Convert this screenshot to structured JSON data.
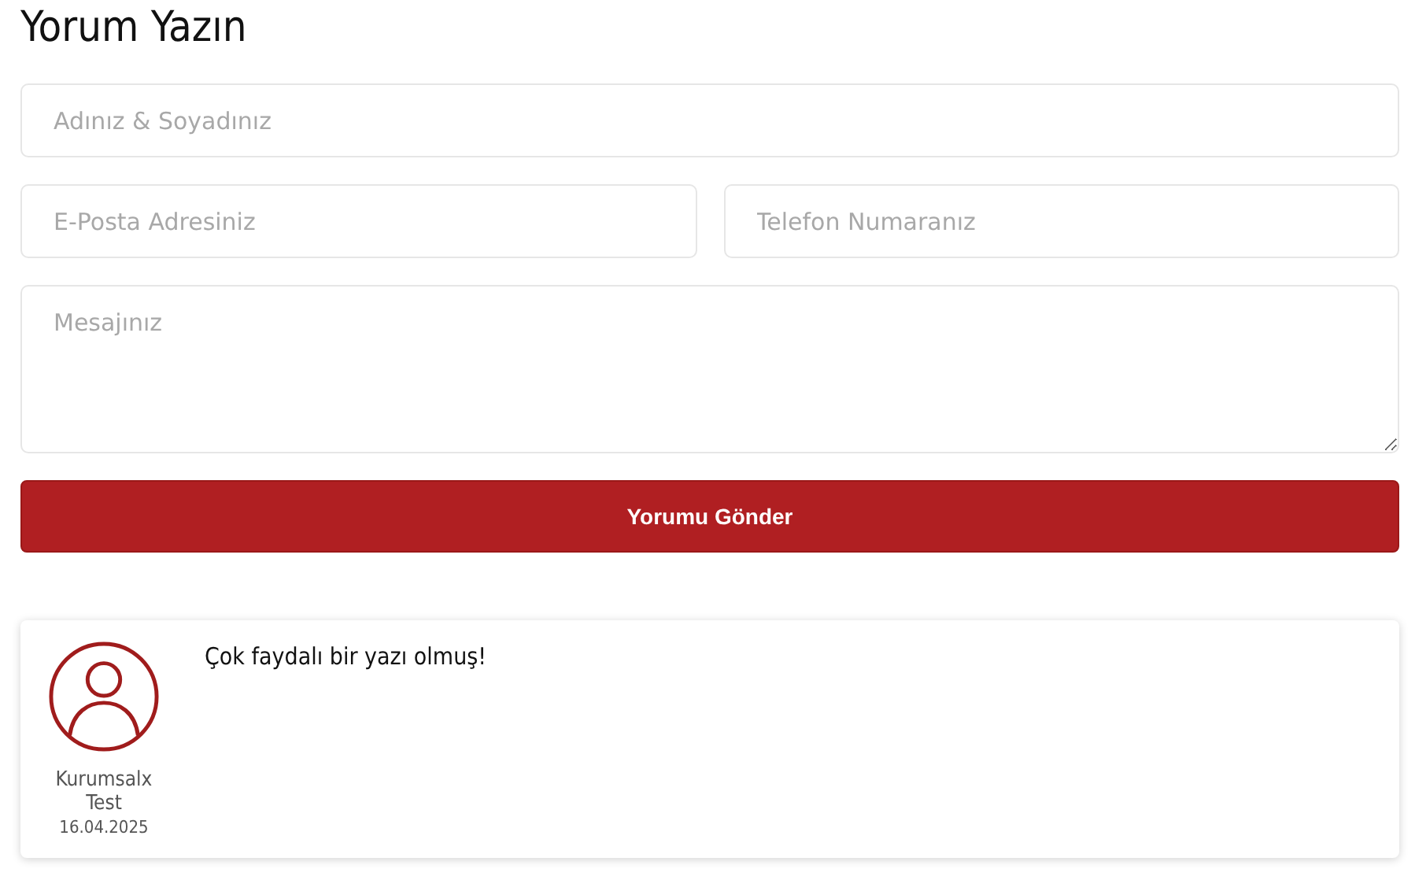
{
  "title": "Yorum Yazın",
  "form": {
    "name": {
      "placeholder": "Adınız & Soyadınız"
    },
    "email": {
      "placeholder": "E-Posta Adresiniz"
    },
    "phone": {
      "placeholder": "Telefon Numaranız"
    },
    "message": {
      "placeholder": "Mesajınız"
    },
    "submit": "Yorumu Gönder"
  },
  "comments": [
    {
      "author": "Kurumsalx Test",
      "date": "16.04.2025",
      "text": "Çok faydalı bir yazı olmuş!"
    }
  ]
}
